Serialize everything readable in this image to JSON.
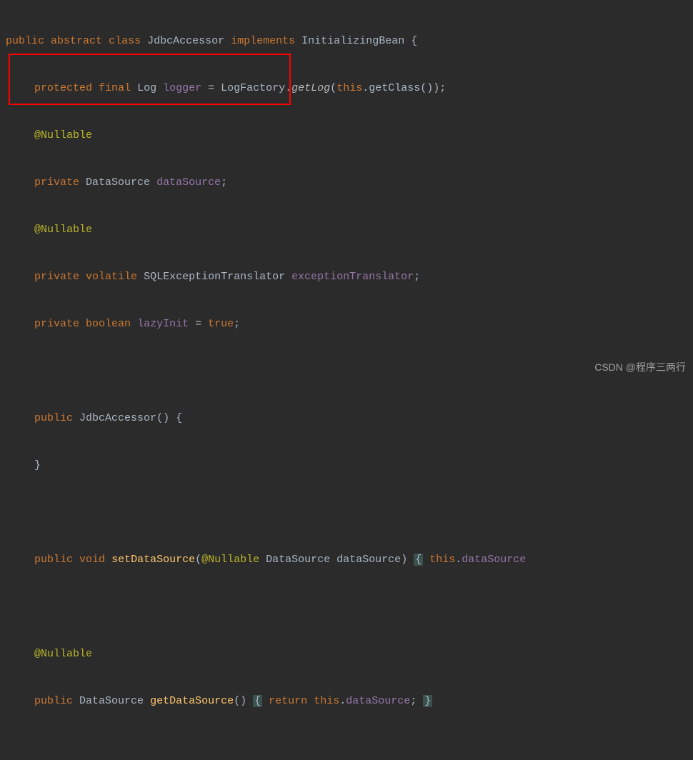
{
  "code": {
    "kw_public": "public",
    "kw_abstract": "abstract",
    "kw_class": "class",
    "kw_implements": "implements",
    "kw_protected": "protected",
    "kw_final": "final",
    "kw_private": "private",
    "kw_volatile": "volatile",
    "kw_boolean": "boolean",
    "kw_void": "void",
    "kw_this": "this",
    "kw_return": "return",
    "kw_true": "true",
    "classname": "JdbcAccessor",
    "interface": "InitializingBean",
    "log_type": "Log",
    "logger_field": "logger",
    "logfactory": "LogFactory",
    "getlog": "getLog",
    "getclass": "getClass",
    "annotation_nullable": "@Nullable",
    "datasource_type": "DataSource",
    "datasource_field": "dataSource",
    "sqltranslator_type": "SQLExceptionTranslator",
    "exceptiontranslator_field": "exceptionTranslator",
    "lazyinit_field": "lazyInit",
    "constructor": "JdbcAccessor",
    "setdatasource": "setDataSource",
    "getdatasource": "getDataSource",
    "param_datasource": "dataSource",
    "eq": " = ",
    "semi": ";",
    "lbrace": "{",
    "rbrace": "}",
    "lparen": "(",
    "rparen": ")",
    "dot": ".",
    "space": " "
  },
  "watermark": "CSDN @程序三两行"
}
